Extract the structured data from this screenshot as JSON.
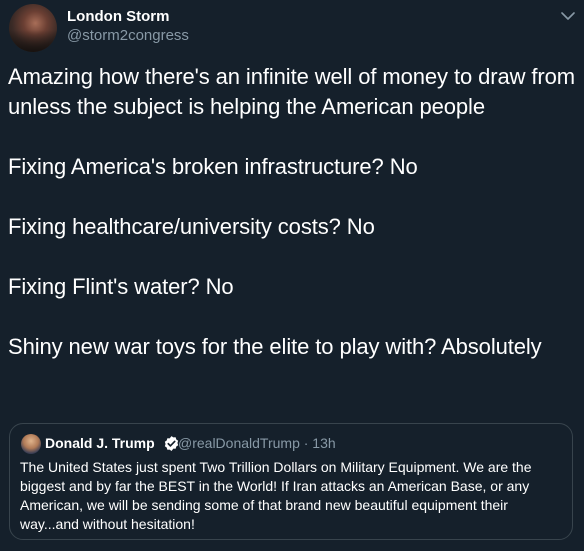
{
  "tweet": {
    "display_name": "London Storm",
    "handle": "@storm2congress",
    "caret_icon": "chevron-down-icon",
    "text": "Amazing how there's an infinite well of money to draw from unless the subject is helping the American people\n\nFixing America's broken infrastructure? No\n\nFixing healthcare/university costs? No\n\nFixing Flint's water? No\n\nShiny new war toys for the elite to play with? Absolutely"
  },
  "quoted_tweet": {
    "display_name": "Donald J. Trump",
    "verified_icon": "verified-badge-icon",
    "handle_time": "@realDonaldTrump · 13h",
    "text": "The United States just spent Two Trillion Dollars on Military Equipment. We are the biggest and by far the BEST in the World! If Iran attacks an American Base, or any American, we will be sending some of that brand new beautiful equipment their way...and without hesitation!"
  },
  "colors": {
    "background": "#15202b",
    "text_primary": "#ffffff",
    "text_secondary": "#8899a6",
    "border": "#38444d",
    "verified": "#ffffff"
  }
}
